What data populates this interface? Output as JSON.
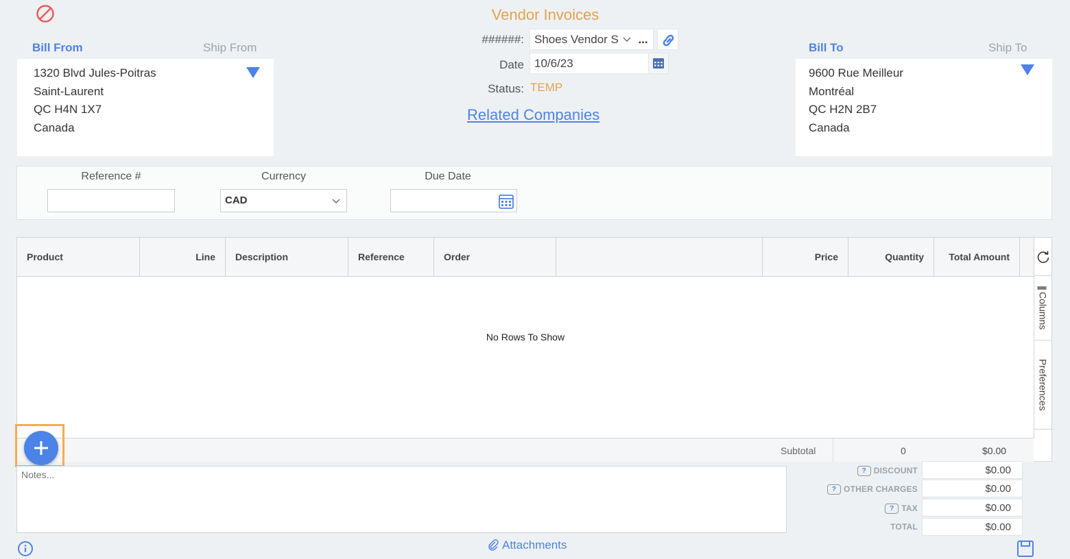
{
  "header": {
    "title": "Vendor Invoices",
    "number_label": "######:",
    "vendor_value": "Shoes Vendor S",
    "more_label": "...",
    "date_label": "Date",
    "date_value": "10/6/23",
    "status_label": "Status:",
    "status_value": "TEMP",
    "related_link": "Related Companies"
  },
  "bill_from": {
    "tab_bill": "Bill From",
    "tab_ship": "Ship From",
    "lines": [
      "1320 Blvd Jules-Poitras",
      "Saint-Laurent",
      "QC H4N 1X7",
      "Canada"
    ]
  },
  "bill_to": {
    "tab_bill": "Bill To",
    "tab_ship": "Ship To",
    "lines": [
      "9600 Rue Meilleur",
      "Montréal",
      "QC H2N 2B7",
      "Canada"
    ]
  },
  "reference": {
    "ref_label": "Reference #",
    "ref_value": "",
    "currency_label": "Currency",
    "currency_value": "CAD",
    "due_label": "Due Date",
    "due_value": ""
  },
  "grid": {
    "columns": [
      "Product",
      "Line",
      "Description",
      "Reference",
      "Order",
      "",
      "Price",
      "Quantity",
      "Total Amount"
    ],
    "empty_text": "No Rows To Show",
    "side_columns": "Columns",
    "side_preferences": "Preferences"
  },
  "footer": {
    "subtotal_label": "Subtotal",
    "subtotal_qty": "0",
    "subtotal_amount": "$0.00"
  },
  "notes": {
    "placeholder": "Notes..."
  },
  "totals": {
    "discount_label": "DISCOUNT",
    "discount_value": "$0.00",
    "other_label": "OTHER CHARGES",
    "other_value": "$0.00",
    "tax_label": "TAX",
    "tax_value": "$0.00",
    "total_label": "TOTAL",
    "total_value": "$0.00"
  },
  "bottom": {
    "attachments": "Attachments"
  },
  "colors": {
    "accent": "#4d83e6",
    "title": "#e4a14f",
    "cancel": "#ee5a5a",
    "highlight": "#f6ab4a"
  }
}
